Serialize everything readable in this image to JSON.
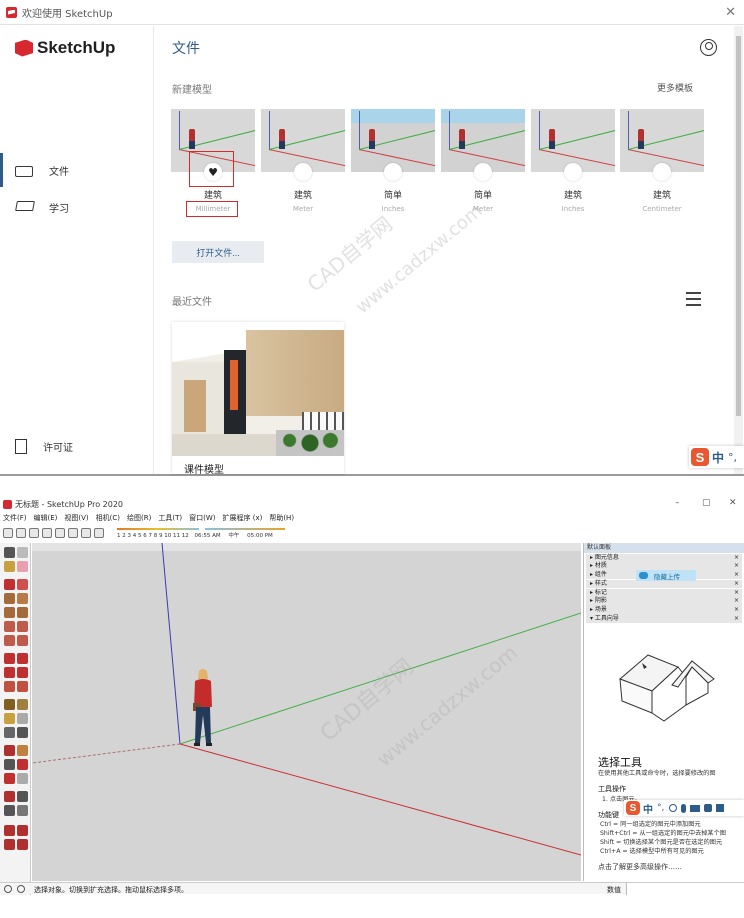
{
  "welcome": {
    "window_title": "欢迎使用 SketchUp",
    "brand": "SketchUp",
    "nav": [
      {
        "label": "文件",
        "icon": "folder-icon"
      },
      {
        "label": "学习",
        "icon": "graduation-cap-icon"
      },
      {
        "label": "许可证",
        "icon": "license-icon"
      }
    ],
    "page_title": "文件",
    "new_model_label": "新建模型",
    "more_templates": "更多模板",
    "templates": [
      {
        "name": "建筑",
        "unit": "Millimeter",
        "selected": true
      },
      {
        "name": "建筑",
        "unit": "Meter"
      },
      {
        "name": "简单",
        "unit": "Inches"
      },
      {
        "name": "简单",
        "unit": "Meter"
      },
      {
        "name": "建筑",
        "unit": "Inches"
      },
      {
        "name": "建筑",
        "unit": "Centimeter"
      }
    ],
    "open_file_button": "打开文件...",
    "recent_files_label": "最近文件",
    "recent_files": [
      {
        "name": "课件模型"
      }
    ],
    "ime": {
      "logo": "S",
      "lang": "中",
      "punct": "°,"
    },
    "colors": {
      "accent": "#2d5c8a",
      "highlight": "#d42a2a",
      "logo": "#d8282f"
    }
  },
  "app": {
    "window_title": "无标题 - SketchUp Pro 2020",
    "window_controls": [
      "–",
      "▢",
      "✕"
    ],
    "menu": [
      "文件(F)",
      "编辑(E)",
      "视图(V)",
      "相机(C)",
      "绘图(R)",
      "工具(T)",
      "窗口(W)",
      "扩展程序 (x)",
      "帮助(H)"
    ],
    "sun_scale": {
      "months": "1 2 3 4 5 6 7 8 9 10 11 12",
      "time_start": "06:55 AM",
      "noon": "中午",
      "time_end": "05:00 PM"
    },
    "tray": {
      "title": "默认面板",
      "sections": [
        "图元信息",
        "材质",
        "组件",
        "样式",
        "标记",
        "阴影",
        "场景",
        "工具向导"
      ],
      "cloud_button": "隐藏上传",
      "instructor_title": "选择工具",
      "instructor_desc": "在使用其他工具或命令时，选择要修改的图",
      "operations_heading": "工具操作",
      "operations": [
        "1. 点击图元。"
      ],
      "modifier_heading": "功能键",
      "modifiers": [
        "Ctrl = 同一组选定的图元中添加图元",
        "Shift+Ctrl = 从一组选定的图元中去掉某个图",
        "Shift = 切换选择某个图元是否在选定的图元",
        "Ctrl+A = 选择模型中所有可见的图元"
      ],
      "more_link": "点击了解更多高级操作……"
    },
    "status_text": "选择对象。切换到扩充选择。拖动鼠标选择多项。",
    "measurement_label": "数值",
    "ime": {
      "logo": "S",
      "lang": "中",
      "punct": "°,"
    }
  },
  "watermarks": [
    "CAD自学网",
    "www.cadzxw.com"
  ]
}
